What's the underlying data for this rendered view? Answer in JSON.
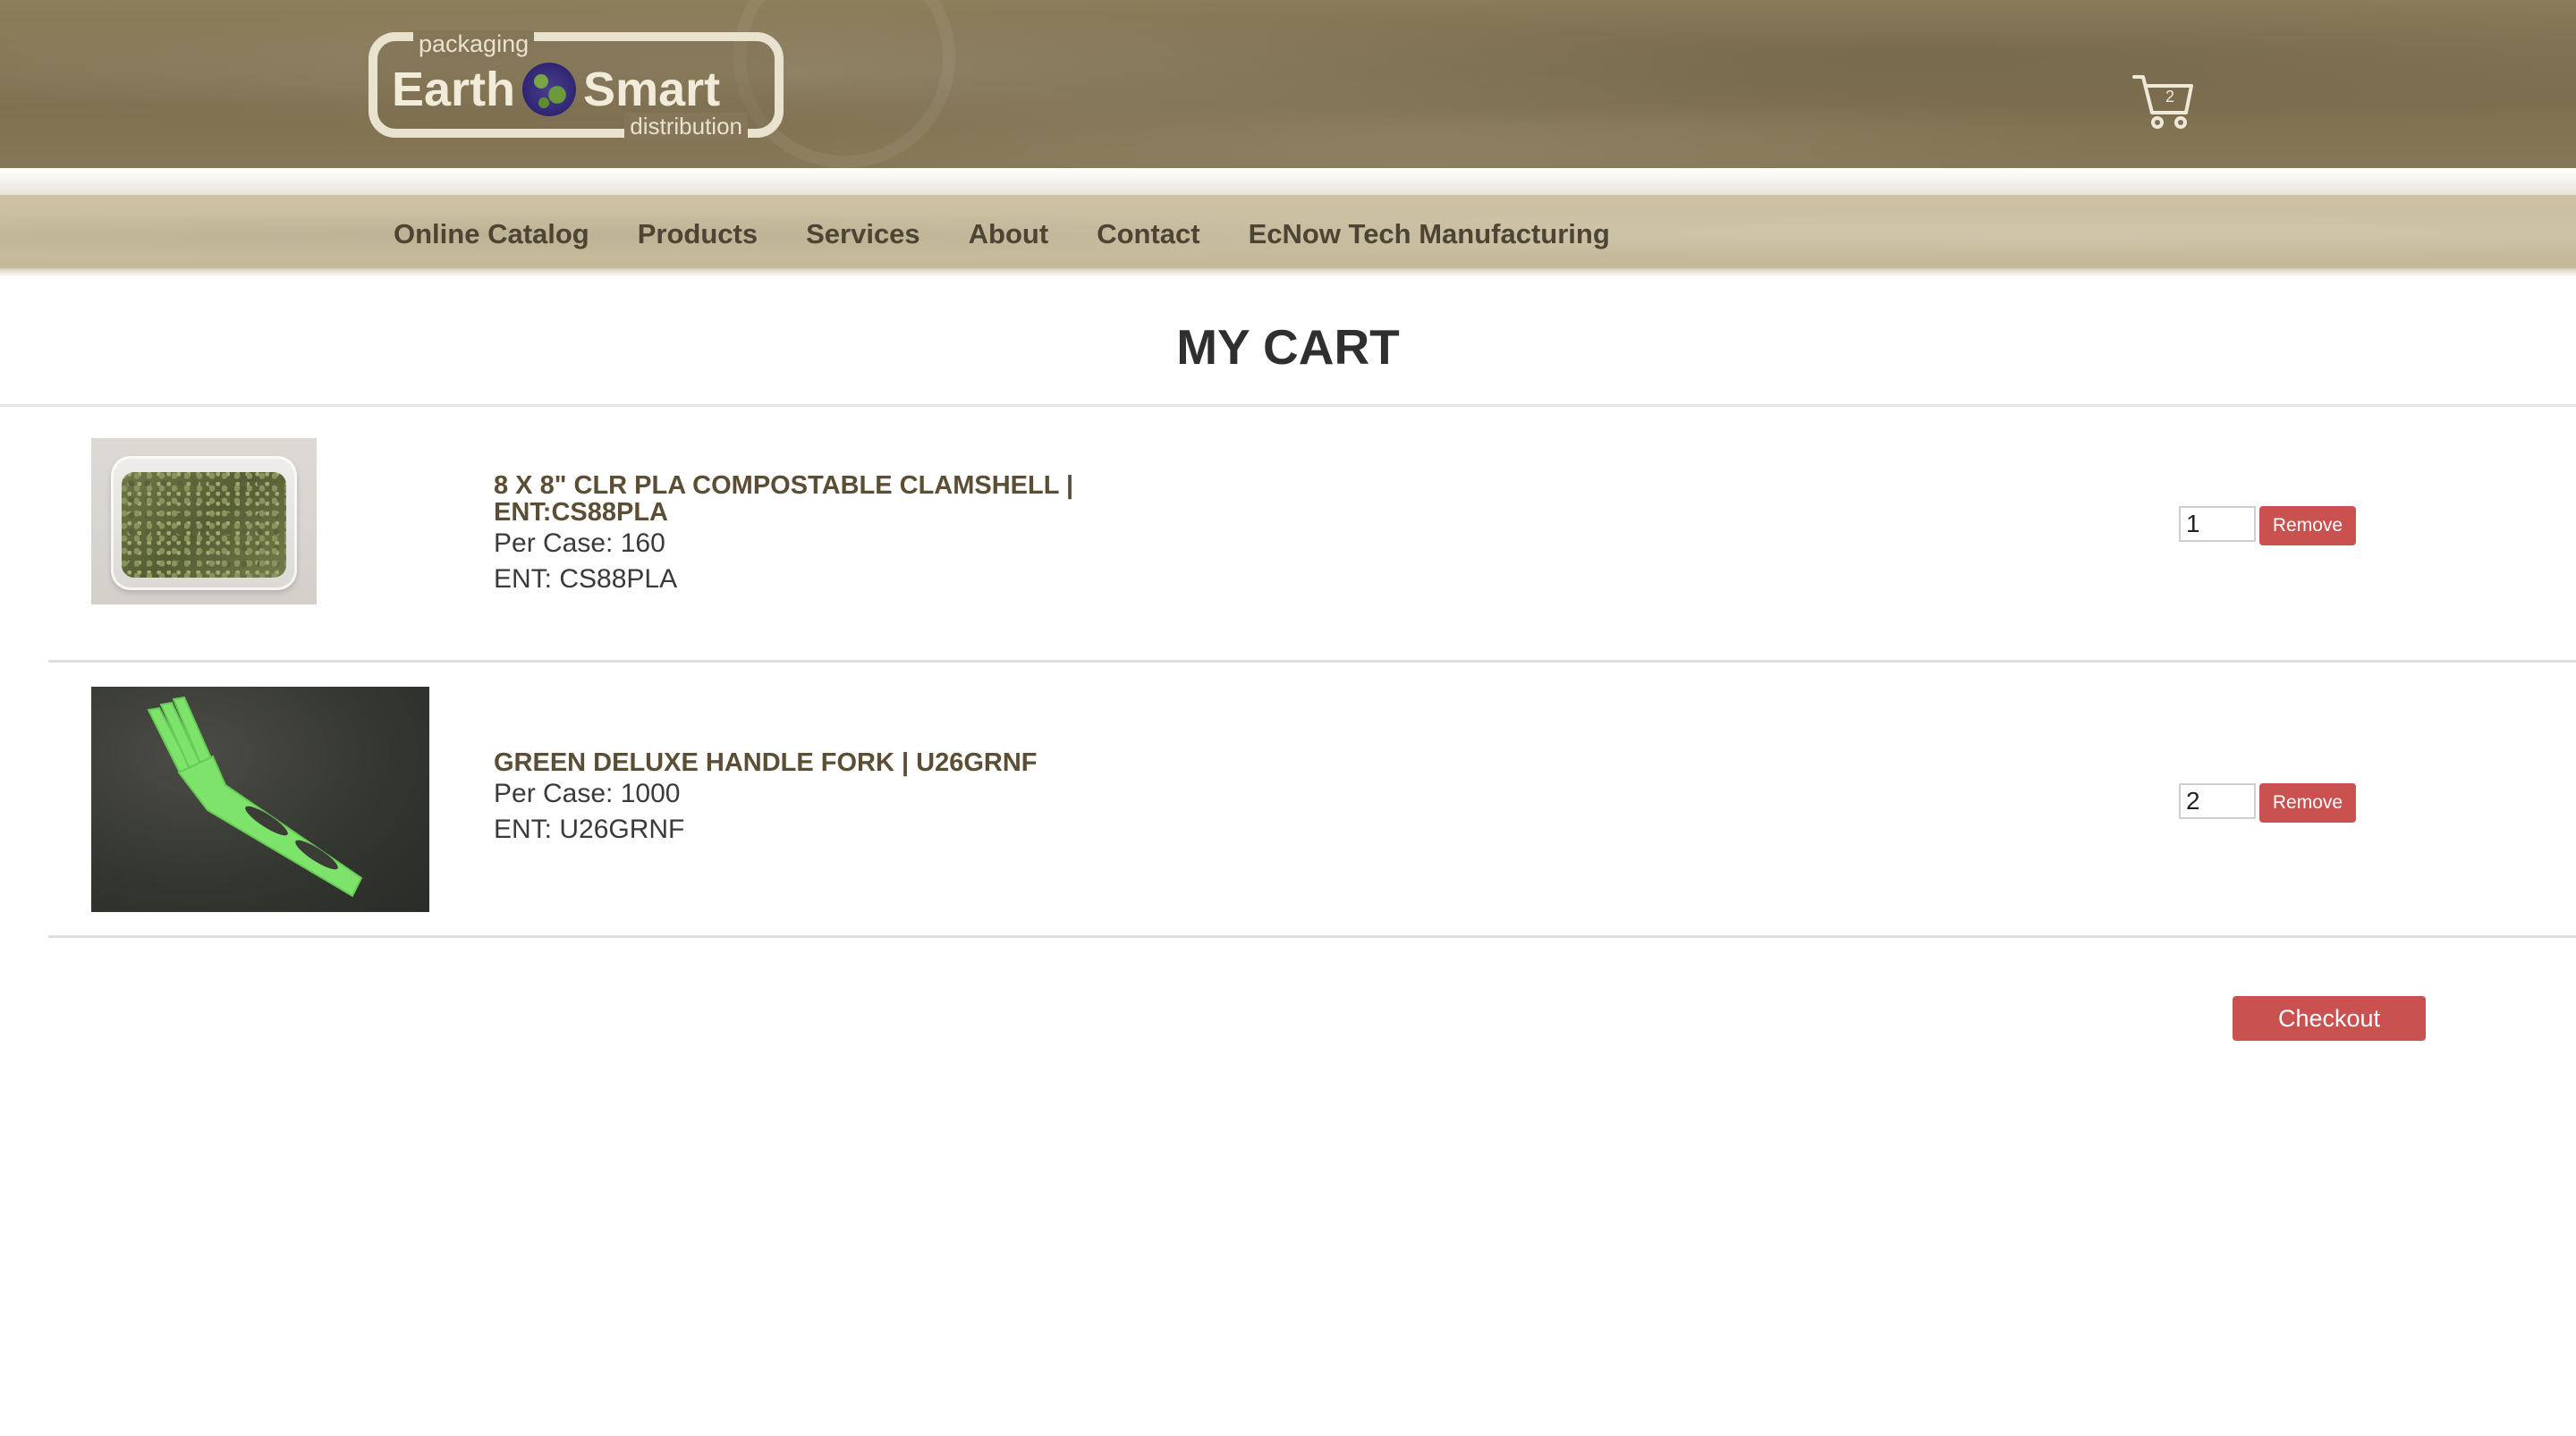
{
  "header": {
    "logo": {
      "top_text": "packaging",
      "word_left": "Earth",
      "word_right": "Smart",
      "bottom_text": "distribution",
      "globe_icon": "globe-icon"
    },
    "cart": {
      "icon": "shopping-cart-icon",
      "count": "2"
    }
  },
  "nav": {
    "items": [
      {
        "label": "Online Catalog"
      },
      {
        "label": "Products"
      },
      {
        "label": "Services"
      },
      {
        "label": "About"
      },
      {
        "label": "Contact"
      },
      {
        "label": "EcNow Tech Manufacturing"
      }
    ]
  },
  "page": {
    "title": "MY CART"
  },
  "cart_items": [
    {
      "name_line1": "8 X 8\" CLR PLA COMPOSTABLE CLAMSHELL |",
      "name_line2": "ENT:CS88PLA",
      "per_case": "Per Case: 160",
      "ent": "ENT: CS88PLA",
      "quantity": "1",
      "remove_label": "Remove"
    },
    {
      "name_line1": "GREEN DELUXE HANDLE FORK | U26GRNF",
      "per_case": "Per Case: 1000",
      "ent": "ENT: U26GRNF",
      "quantity": "2",
      "remove_label": "Remove"
    }
  ],
  "checkout_label": "Checkout",
  "colors": {
    "accent_button": "#c9514f",
    "header_brown": "#7f7050",
    "nav_tan": "#c3b898",
    "product_name": "#5b4e34"
  }
}
